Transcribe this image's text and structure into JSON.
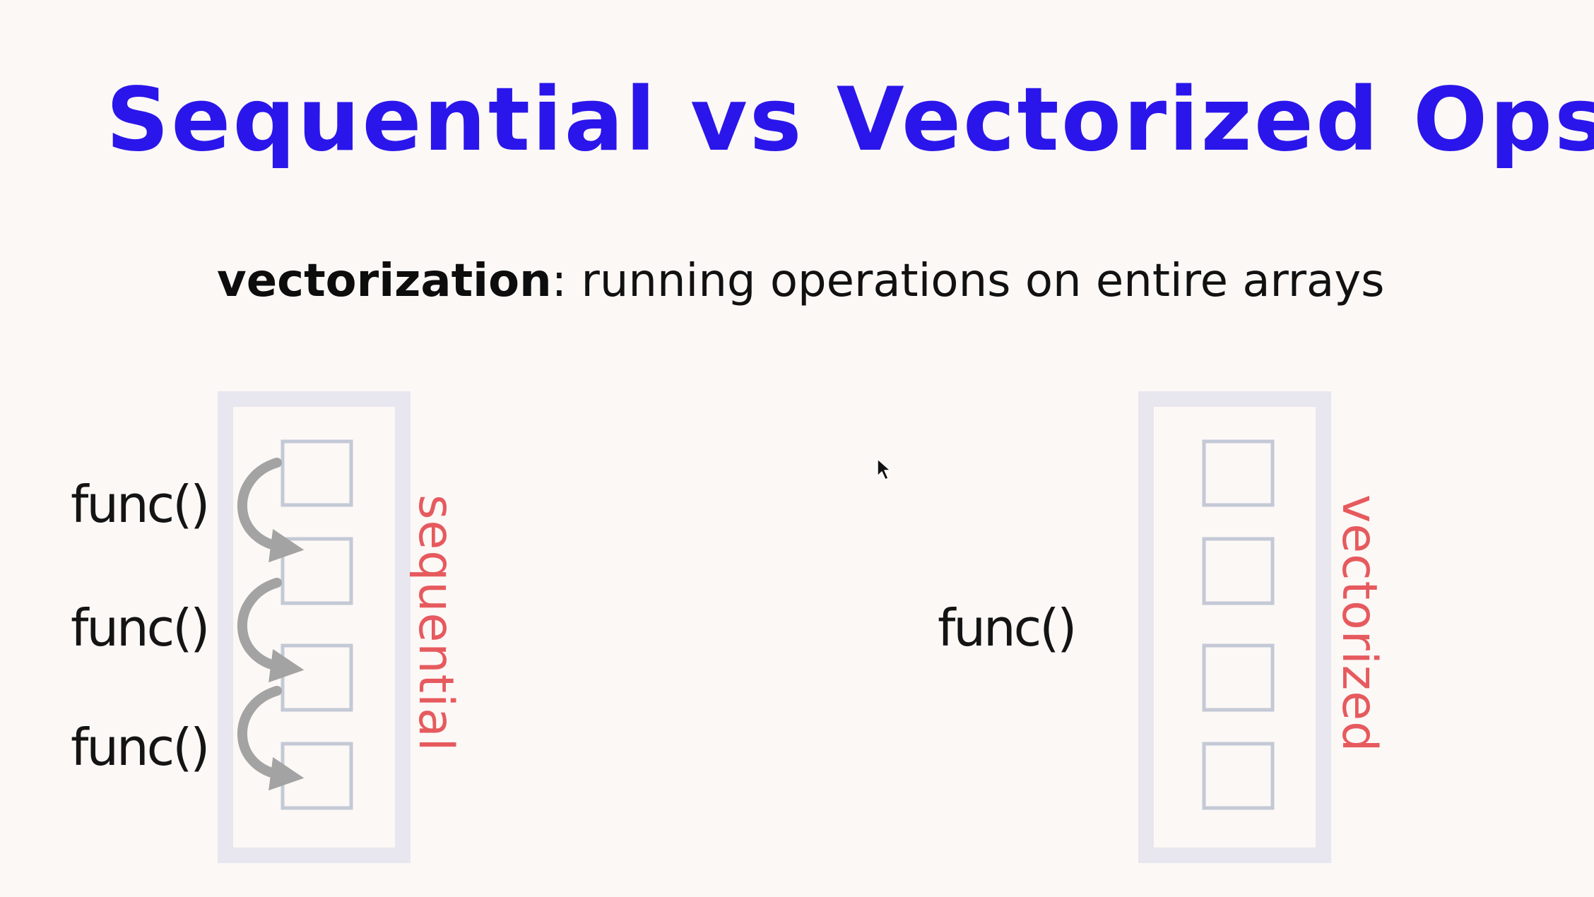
{
  "slide": {
    "title": "Sequential vs Vectorized Ops",
    "subtitle": {
      "term": "vectorization",
      "definition": ": running operations on entire arrays"
    }
  },
  "sequential": {
    "label": "sequential",
    "funcs": [
      "func()",
      "func()",
      "func()"
    ],
    "cell_count": 4,
    "arrow_count": 3
  },
  "vectorized": {
    "label": "vectorized",
    "func": "func()",
    "cell_count": 4
  },
  "colors": {
    "title": "#2a16ea",
    "side_label": "#e65a5e",
    "array_frame": "#e8e6ee",
    "cell_stroke": "#c4c9d6",
    "arrow": "#a3a3a3",
    "background": "#fcf8f6"
  },
  "icons": [
    "curved-arrow-icon",
    "mouse-cursor-icon"
  ]
}
